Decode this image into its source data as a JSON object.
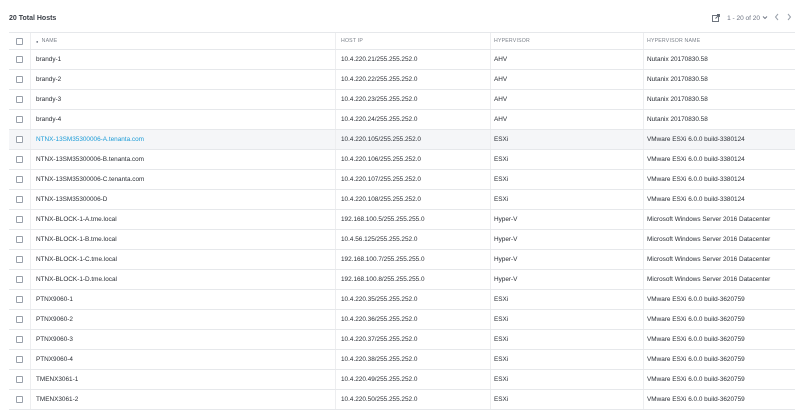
{
  "header": {
    "total_label": "20 Total Hosts",
    "pagination": "1 - 20 of 20",
    "icons": {
      "export": "export-icon",
      "dropdown": "chevron-down-icon",
      "prev": "chevron-left-icon",
      "next": "chevron-right-icon"
    }
  },
  "table": {
    "columns": [
      "Name",
      "Host IP",
      "Hypervisor",
      "Hypervisor Name"
    ],
    "sorted_column": "Name",
    "link_color": "#1a9bd7",
    "rows": [
      {
        "name": "brandy-1",
        "ip": "10.4.220.21/255.255.252.0",
        "hypervisor": "AHV",
        "hv_name": "Nutanix 20170830.58"
      },
      {
        "name": "brandy-2",
        "ip": "10.4.220.22/255.255.252.0",
        "hypervisor": "AHV",
        "hv_name": "Nutanix 20170830.58"
      },
      {
        "name": "brandy-3",
        "ip": "10.4.220.23/255.255.252.0",
        "hypervisor": "AHV",
        "hv_name": "Nutanix 20170830.58"
      },
      {
        "name": "brandy-4",
        "ip": "10.4.220.24/255.255.252.0",
        "hypervisor": "AHV",
        "hv_name": "Nutanix 20170830.58"
      },
      {
        "name": "NTNX-13SM35300006-A.tenanta.com",
        "ip": "10.4.220.105/255.255.252.0",
        "hypervisor": "ESXi",
        "hv_name": "VMware ESXi 6.0.0 build-3380124",
        "highlight": true
      },
      {
        "name": "NTNX-13SM35300006-B.tenanta.com",
        "ip": "10.4.220.106/255.255.252.0",
        "hypervisor": "ESXi",
        "hv_name": "VMware ESXi 6.0.0 build-3380124"
      },
      {
        "name": "NTNX-13SM35300006-C.tenanta.com",
        "ip": "10.4.220.107/255.255.252.0",
        "hypervisor": "ESXi",
        "hv_name": "VMware ESXi 6.0.0 build-3380124"
      },
      {
        "name": "NTNX-13SM35300006-D",
        "ip": "10.4.220.108/255.255.252.0",
        "hypervisor": "ESXi",
        "hv_name": "VMware ESXi 6.0.0 build-3380124"
      },
      {
        "name": "NTNX-BLOCK-1-A.tme.local",
        "ip": "192.168.100.5/255.255.255.0",
        "hypervisor": "Hyper-V",
        "hv_name": "Microsoft Windows Server 2016 Datacenter"
      },
      {
        "name": "NTNX-BLOCK-1-B.tme.local",
        "ip": "10.4.56.125/255.255.252.0",
        "hypervisor": "Hyper-V",
        "hv_name": "Microsoft Windows Server 2016 Datacenter"
      },
      {
        "name": "NTNX-BLOCK-1-C.tme.local",
        "ip": "192.168.100.7/255.255.255.0",
        "hypervisor": "Hyper-V",
        "hv_name": "Microsoft Windows Server 2016 Datacenter"
      },
      {
        "name": "NTNX-BLOCK-1-D.tme.local",
        "ip": "192.168.100.8/255.255.255.0",
        "hypervisor": "Hyper-V",
        "hv_name": "Microsoft Windows Server 2016 Datacenter"
      },
      {
        "name": "PTNX9060-1",
        "ip": "10.4.220.35/255.255.252.0",
        "hypervisor": "ESXi",
        "hv_name": "VMware ESXi 6.0.0 build-3620759"
      },
      {
        "name": "PTNX9060-2",
        "ip": "10.4.220.36/255.255.252.0",
        "hypervisor": "ESXi",
        "hv_name": "VMware ESXi 6.0.0 build-3620759"
      },
      {
        "name": "PTNX9060-3",
        "ip": "10.4.220.37/255.255.252.0",
        "hypervisor": "ESXi",
        "hv_name": "VMware ESXi 6.0.0 build-3620759"
      },
      {
        "name": "PTNX9060-4",
        "ip": "10.4.220.38/255.255.252.0",
        "hypervisor": "ESXi",
        "hv_name": "VMware ESXi 6.0.0 build-3620759"
      },
      {
        "name": "TMENX3061-1",
        "ip": "10.4.220.49/255.255.252.0",
        "hypervisor": "ESXi",
        "hv_name": "VMware ESXi 6.0.0 build-3620759"
      },
      {
        "name": "TMENX3061-2",
        "ip": "10.4.220.50/255.255.252.0",
        "hypervisor": "ESXi",
        "hv_name": "VMware ESXi 6.0.0 build-3620759"
      }
    ]
  }
}
